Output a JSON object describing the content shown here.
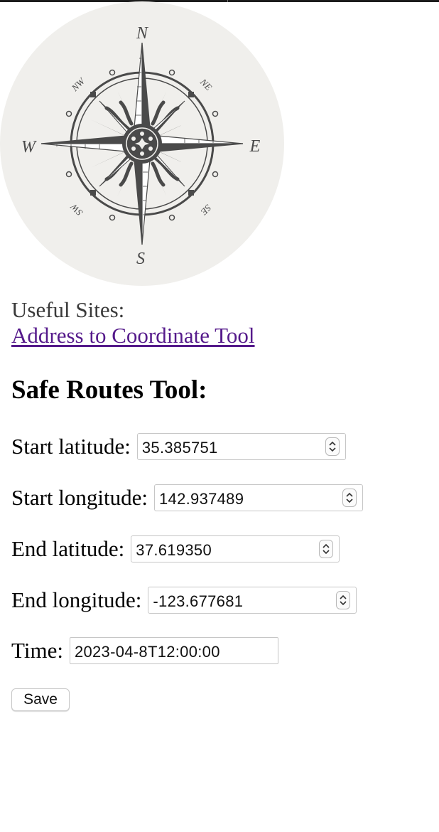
{
  "useful_sites": {
    "label": "Useful Sites:",
    "link_text": "Address to Coordinate Tool"
  },
  "compass": {
    "n": "N",
    "s": "S",
    "e": "E",
    "w": "W",
    "nw": "NW",
    "ne": "NE",
    "sw": "SW",
    "se": "SE",
    "icon": "compass-rose-icon",
    "background_color": "#f0efec",
    "ink_color": "#4a4a4a"
  },
  "form": {
    "title": "Safe Routes Tool:",
    "fields": [
      {
        "label": "Start latitude:",
        "value": "35.385751"
      },
      {
        "label": "Start longitude:",
        "value": "142.937489"
      },
      {
        "label": "End latitude:",
        "value": "37.619350"
      },
      {
        "label": "End longitude:",
        "value": "-123.677681"
      },
      {
        "label": "Time:",
        "value": "2023-04-8T12:00:00"
      }
    ],
    "save_label": "Save"
  },
  "colors": {
    "link": "#551a8b",
    "text": "#000000",
    "muted_text": "#3a3a3a"
  }
}
